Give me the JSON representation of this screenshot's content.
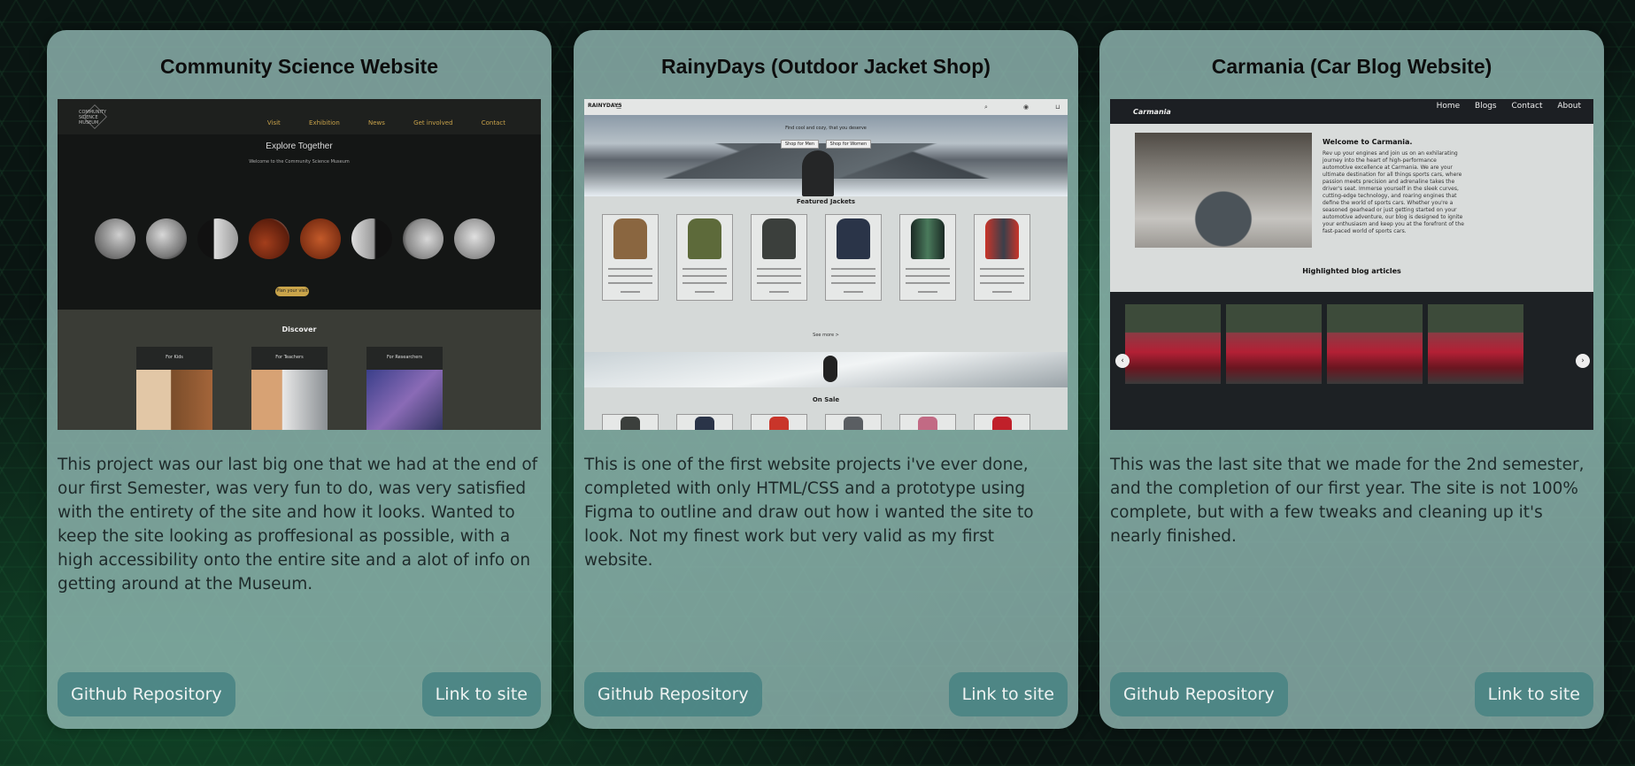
{
  "cards": [
    {
      "title": "Community Science Website",
      "description": "This project was our last big one that we had at the end of our first Semester, was very fun to do, was very satisfied with the entirety of the site and how it looks. Wanted to keep the site looking as proffesional as possible, with a high accessibility onto the entire site and a alot of info on getting around at the Museum.",
      "github_label": "Github Repository",
      "site_label": "Link to site",
      "preview": {
        "logo": "COMMUNITY SCIENCE MUSEUM",
        "nav": [
          "Visit",
          "Exhibition",
          "News",
          "Get involved",
          "Contact"
        ],
        "hero_title": "Explore Together",
        "hero_subtitle": "Welcome to the Community Science Museum",
        "cta": "Plan your visit",
        "discover_title": "Discover",
        "discover_cards": [
          "For Kids",
          "For Teachers",
          "For Researchers"
        ]
      }
    },
    {
      "title": "RainyDays (Outdoor Jacket Shop)",
      "description": "This is one of the first website projects i've ever done, completed with only HTML/CSS and a prototype using Figma to outline and draw out how i wanted the site to look. Not my finest work but very valid as my first website.",
      "github_label": "Github Repository",
      "site_label": "Link to site",
      "preview": {
        "brand": "RAINYDAYS",
        "hero_text": "Find cool and cozy, that you deserve",
        "hero_buttons": [
          "Shop for Men",
          "Shop for Women"
        ],
        "featured_title": "Featured Jackets",
        "see_more": "See more >",
        "on_sale_title": "On Sale"
      }
    },
    {
      "title": "Carmania (Car Blog Website)",
      "description": "This was the last site that we made for the 2nd semester, and the completion of our first year. The site is not 100% complete, but with a few tweaks and cleaning up it's nearly finished.",
      "github_label": "Github Repository",
      "site_label": "Link to site",
      "preview": {
        "brand": "Carmania",
        "nav": [
          "Home",
          "Blogs",
          "Contact",
          "About"
        ],
        "welcome_title": "Welcome to Carmania.",
        "welcome_text": "Rev up your engines and join us on an exhilarating journey into the heart of high-performance automotive excellence at Carmania. We are your ultimate destination for all things sports cars, where passion meets precision and adrenaline takes the driver's seat. Immerse yourself in the sleek curves, cutting-edge technology, and roaring engines that define the world of sports cars. Whether you're a seasoned gearhead or just getting started on your automotive adventure, our blog is designed to ignite your enthusiasm and keep you at the forefront of the fast-paced world of sports cars.",
        "highlighted_title": "Highlighted blog articles"
      }
    }
  ]
}
